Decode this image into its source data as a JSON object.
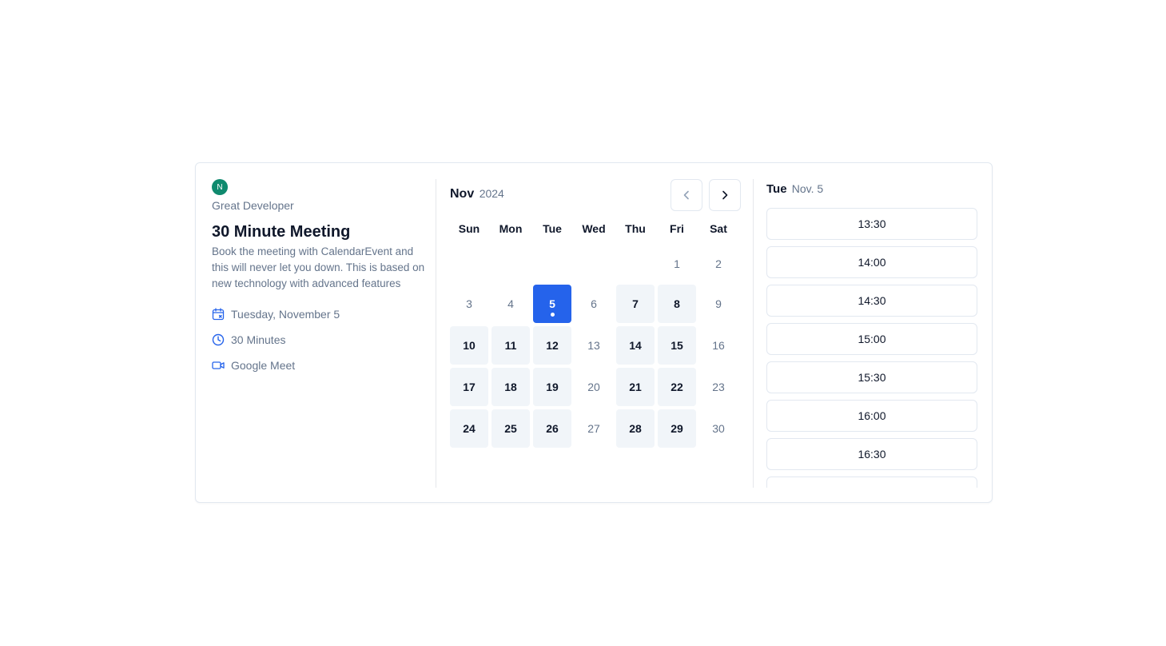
{
  "host": {
    "avatar_letter": "N",
    "name": "Great Developer"
  },
  "event": {
    "title": "30 Minute Meeting",
    "description": "Book the meeting with CalendarEvent and this will never let you down. This is based on new technology with advanced features",
    "date_label": "Tuesday, November 5",
    "duration_label": "30 Minutes",
    "location_label": "Google Meet"
  },
  "calendar": {
    "month": "Nov",
    "year": "2024",
    "weekdays": [
      "Sun",
      "Mon",
      "Tue",
      "Wed",
      "Thu",
      "Fri",
      "Sat"
    ],
    "leading_blanks": 5,
    "days": [
      {
        "d": "1",
        "s": "off"
      },
      {
        "d": "2",
        "s": "off"
      },
      {
        "d": "3",
        "s": "off"
      },
      {
        "d": "4",
        "s": "off"
      },
      {
        "d": "5",
        "s": "sel"
      },
      {
        "d": "6",
        "s": "off"
      },
      {
        "d": "7",
        "s": "avail"
      },
      {
        "d": "8",
        "s": "avail"
      },
      {
        "d": "9",
        "s": "off"
      },
      {
        "d": "10",
        "s": "avail"
      },
      {
        "d": "11",
        "s": "avail"
      },
      {
        "d": "12",
        "s": "avail"
      },
      {
        "d": "13",
        "s": "off"
      },
      {
        "d": "14",
        "s": "avail"
      },
      {
        "d": "15",
        "s": "avail"
      },
      {
        "d": "16",
        "s": "off"
      },
      {
        "d": "17",
        "s": "avail"
      },
      {
        "d": "18",
        "s": "avail"
      },
      {
        "d": "19",
        "s": "avail"
      },
      {
        "d": "20",
        "s": "off"
      },
      {
        "d": "21",
        "s": "avail"
      },
      {
        "d": "22",
        "s": "avail"
      },
      {
        "d": "23",
        "s": "off"
      },
      {
        "d": "24",
        "s": "avail"
      },
      {
        "d": "25",
        "s": "avail"
      },
      {
        "d": "26",
        "s": "avail"
      },
      {
        "d": "27",
        "s": "off"
      },
      {
        "d": "28",
        "s": "avail"
      },
      {
        "d": "29",
        "s": "avail"
      },
      {
        "d": "30",
        "s": "off"
      }
    ]
  },
  "slots": {
    "day": "Tue",
    "date": "Nov. 5",
    "times": [
      "13:30",
      "14:00",
      "14:30",
      "15:00",
      "15:30",
      "16:00",
      "16:30",
      ""
    ]
  },
  "colors": {
    "accent": "#2563eb",
    "avatar": "#0f8a6e"
  }
}
